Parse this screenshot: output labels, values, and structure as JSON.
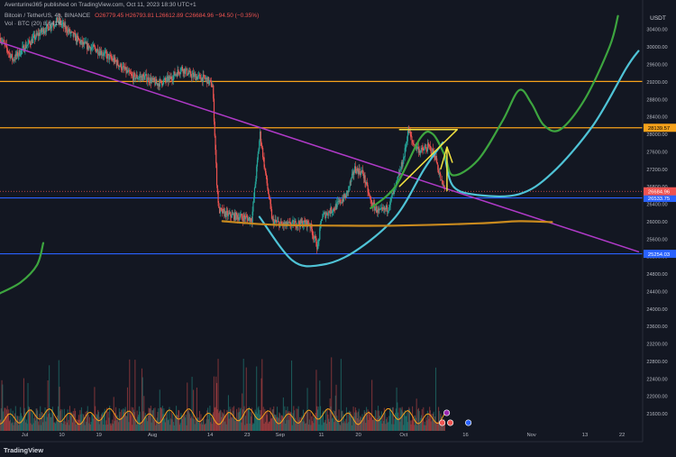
{
  "header": {
    "published_by": "Aventurine365 published on TradingView.com, Oct 11, 2023 18:30 UTC+1",
    "symbol": "Bitcoin / TetherUS, 4h, BINANCE",
    "ohlc": "O26779.45 H26793.81 L26612.89 C26684.96 −94.50 (−0.35%)",
    "volume": "Vol · BTC (20)  8.641K"
  },
  "footer": {
    "brand": "TradingView"
  },
  "colors": {
    "background": "#131722",
    "up": "#26a69a",
    "down": "#ef5350",
    "orange": "#f7a21b",
    "blue": "#2962ff",
    "purple": "#b03ac8",
    "green": "#3da53f",
    "cyan": "#4fc3d6",
    "yellow": "#f2e240",
    "bronze": "#c98a1e"
  },
  "chart_data": {
    "type": "candlestick",
    "symbol": "BTCUSDT",
    "timeframe": "4h",
    "y_axis_label": "USDT",
    "yticks": [
      30400,
      30000,
      29600,
      29200,
      28800,
      28400,
      28000,
      27600,
      27200,
      26800,
      26400,
      26000,
      25600,
      25200,
      24800,
      24400,
      24000,
      23600,
      23200,
      22800,
      22400,
      22000,
      21600
    ],
    "ylim": [
      21200,
      30900
    ],
    "x_ticks": [
      "Jul",
      "10",
      "19",
      "Aug",
      "14",
      "23",
      "Sep",
      "11",
      "20",
      "Oct",
      "16",
      "Nov",
      "13",
      "22"
    ],
    "x_tick_days": [
      0,
      9,
      18,
      31,
      45,
      54,
      62,
      72,
      81,
      92,
      107,
      123,
      136,
      145
    ],
    "x_day_range": [
      -6,
      150
    ],
    "last_day": 102,
    "horizontal_levels": [
      {
        "value": 29200,
        "color": "orange"
      },
      {
        "value": 28139.57,
        "color": "orange",
        "label": "28139.57"
      },
      {
        "value": 26533.75,
        "color": "blue",
        "label": "26533.75"
      },
      {
        "value": 25254.03,
        "color": "blue",
        "label": "25254.03"
      }
    ],
    "current_price": {
      "value": 26684.96,
      "label": "26684.96"
    },
    "price_anchors": [
      [
        -6,
        30200
      ],
      [
        -3,
        29700
      ],
      [
        0,
        30000
      ],
      [
        4,
        30350
      ],
      [
        8,
        30600
      ],
      [
        11,
        30300
      ],
      [
        14,
        30050
      ],
      [
        18,
        29900
      ],
      [
        22,
        29650
      ],
      [
        26,
        29300
      ],
      [
        29,
        29300
      ],
      [
        32,
        29150
      ],
      [
        35,
        29250
      ],
      [
        38,
        29500
      ],
      [
        40,
        29350
      ],
      [
        44,
        29250
      ],
      [
        45.5,
        29100
      ],
      [
        46.5,
        26900
      ],
      [
        47,
        26250
      ],
      [
        49,
        26150
      ],
      [
        52,
        26100
      ],
      [
        55,
        26050
      ],
      [
        57,
        28000
      ],
      [
        58,
        27300
      ],
      [
        60,
        26000
      ],
      [
        63,
        25900
      ],
      [
        66,
        25950
      ],
      [
        69,
        25950
      ],
      [
        71,
        25400
      ],
      [
        72,
        26100
      ],
      [
        75,
        26300
      ],
      [
        78,
        26600
      ],
      [
        80,
        27200
      ],
      [
        82,
        27100
      ],
      [
        84,
        26400
      ],
      [
        86,
        26200
      ],
      [
        88,
        26300
      ],
      [
        90,
        26800
      ],
      [
        92,
        27500
      ],
      [
        93,
        28100
      ],
      [
        94,
        27800
      ],
      [
        96,
        27600
      ],
      [
        98,
        27700
      ],
      [
        99.5,
        27500
      ],
      [
        101,
        26900
      ],
      [
        102,
        26684.96
      ]
    ],
    "drawings": [
      {
        "type": "trendline",
        "color": "purple",
        "points": [
          [
            -6,
            30100
          ],
          [
            149,
            25300
          ]
        ]
      },
      {
        "type": "curve",
        "color": "cyan",
        "points": [
          [
            57,
            26100
          ],
          [
            65,
            25100
          ],
          [
            72,
            25000
          ],
          [
            80,
            25300
          ],
          [
            90,
            26100
          ],
          [
            97,
            27200
          ],
          [
            101.5,
            27800
          ]
        ]
      },
      {
        "type": "curve",
        "color": "cyan",
        "points": [
          [
            102,
            27500
          ],
          [
            104,
            26800
          ],
          [
            110,
            26600
          ],
          [
            120,
            26620
          ],
          [
            128,
            27100
          ],
          [
            138,
            28200
          ],
          [
            146,
            29500
          ],
          [
            149,
            29900
          ]
        ]
      },
      {
        "type": "curve",
        "color": "green",
        "points": [
          [
            -6,
            24350
          ],
          [
            -1,
            24600
          ],
          [
            3,
            25000
          ],
          [
            4.5,
            25500
          ]
        ]
      },
      {
        "type": "curve",
        "color": "green",
        "points": [
          [
            84,
            26300
          ],
          [
            90,
            26800
          ],
          [
            96,
            27900
          ],
          [
            99,
            28000
          ],
          [
            102,
            27500
          ],
          [
            104,
            27050
          ],
          [
            110,
            27400
          ],
          [
            116,
            28300
          ],
          [
            120,
            29000
          ],
          [
            123,
            28700
          ],
          [
            126,
            28200
          ],
          [
            130,
            28100
          ],
          [
            136,
            28800
          ],
          [
            142,
            30000
          ],
          [
            144,
            30700
          ]
        ]
      },
      {
        "type": "curve",
        "color": "bronze",
        "points": [
          [
            48,
            26000
          ],
          [
            60,
            25920
          ],
          [
            75,
            25900
          ],
          [
            90,
            25900
          ],
          [
            110,
            25950
          ],
          [
            120,
            26000
          ],
          [
            128,
            25980
          ]
        ]
      },
      {
        "type": "polyline",
        "color": "yellow",
        "points": [
          [
            91,
            28100
          ],
          [
            105,
            28100
          ],
          [
            91,
            26800
          ]
        ]
      },
      {
        "type": "polyline",
        "color": "yellow",
        "points": [
          [
            102.5,
            27700
          ],
          [
            102.5,
            26700
          ]
        ]
      },
      {
        "type": "polyline",
        "color": "yellow",
        "points": [
          [
            101,
            27200
          ],
          [
            102.5,
            27700
          ],
          [
            103.8,
            27350
          ]
        ]
      }
    ],
    "volume_series": {
      "type": "area",
      "label": "Vol · BTC (20)",
      "value": "8.641K"
    },
    "grid": false,
    "legend": "top-left"
  }
}
